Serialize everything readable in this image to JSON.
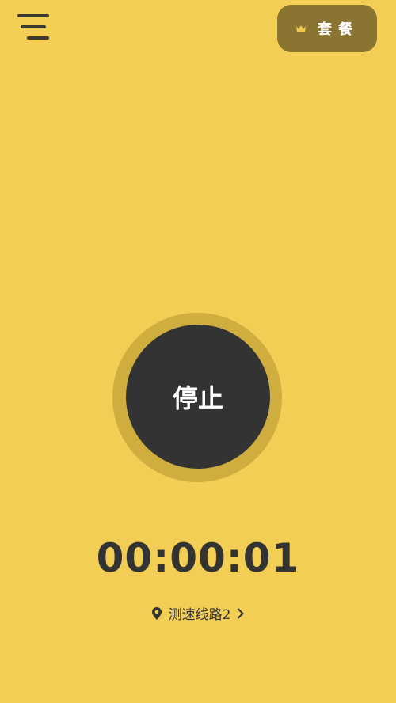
{
  "colors": {
    "background": "#F2CE55",
    "button_dark": "#333333",
    "ring": "#CFAE3F",
    "plan_button_bg": "#8A7431",
    "accent_crown": "#F2C94C",
    "text_light": "#FFFFFF",
    "text_dark": "#333333"
  },
  "header": {
    "menu_icon": "menu-icon",
    "plan_label": "套餐",
    "plan_icon": "crown-icon"
  },
  "main": {
    "stop_label": "停止",
    "timer": "00:00:01",
    "route_label": "测速线路2",
    "route_icon": "location-pin-icon",
    "route_chevron": "chevron-right-icon"
  }
}
